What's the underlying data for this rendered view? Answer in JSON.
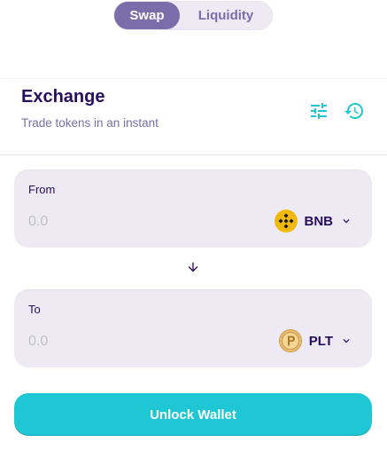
{
  "nav": {
    "tabs": [
      {
        "label": "Swap",
        "active": true
      },
      {
        "label": "Liquidity",
        "active": false
      }
    ]
  },
  "exchange": {
    "title": "Exchange",
    "subtitle": "Trade tokens in an instant",
    "icons": [
      "settings-sliders-icon",
      "history-icon"
    ]
  },
  "from": {
    "label": "From",
    "amount_placeholder": "0.0",
    "token": "BNB",
    "token_icon": "bnb-coin-icon"
  },
  "to": {
    "label": "To",
    "amount_placeholder": "0.0",
    "token": "PLT",
    "token_icon": "plt-coin-icon"
  },
  "action": {
    "label": "Unlock Wallet"
  },
  "colors": {
    "primary": "#1FC7D4",
    "secondary": "#7A6EAA",
    "text": "#280D5F",
    "input_bg": "#EEEAF4",
    "bnb": "#F0B90B",
    "plt": "#D9A441"
  }
}
